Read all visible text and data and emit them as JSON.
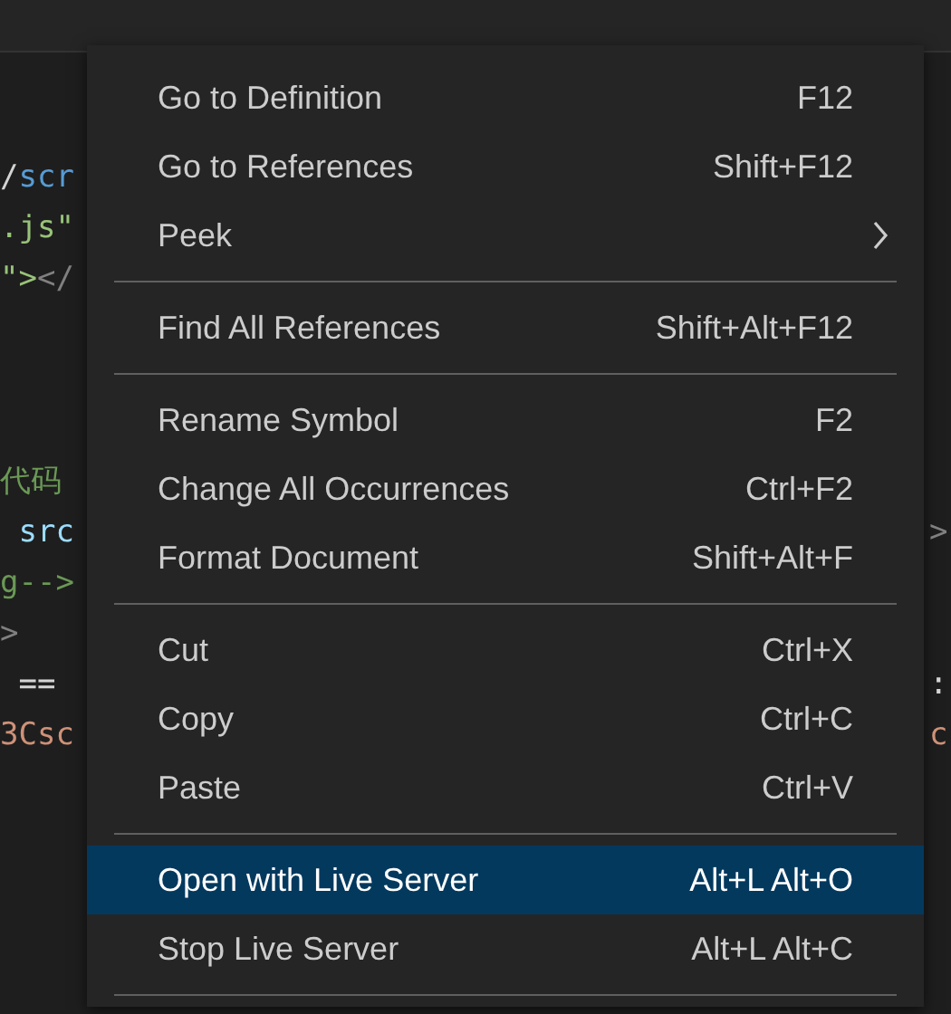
{
  "editor_left": [
    {
      "lines": [
        {
          "segments": [
            {
              "text": "/",
              "kind": "plain"
            },
            {
              "text": "scr",
              "kind": "tag"
            }
          ]
        },
        {
          "segments": [
            {
              "text": ".js\"",
              "kind": "string"
            }
          ]
        },
        {
          "segments": [
            {
              "text": "\">",
              "kind": "string"
            },
            {
              "text": "</",
              "kind": "punct"
            }
          ]
        }
      ]
    },
    {
      "lines": [
        {
          "segments": [
            {
              "text": "代码",
              "kind": "comment"
            }
          ]
        },
        {
          "segments": [
            {
              "text": " src",
              "kind": "attr"
            }
          ]
        },
        {
          "segments": [
            {
              "text": "g-->",
              "kind": "comment"
            }
          ]
        },
        {
          "segments": [
            {
              "text": ">",
              "kind": "punct"
            }
          ]
        },
        {
          "segments": [
            {
              "text": " == ",
              "kind": "plain"
            }
          ]
        },
        {
          "segments": [
            {
              "text": "3Csc",
              "kind": "string2"
            }
          ]
        }
      ]
    }
  ],
  "editor_right": [
    {
      "text": ">",
      "kind": "punct"
    },
    {
      "text": ":",
      "kind": "plain"
    },
    {
      "text": "c",
      "kind": "string2"
    }
  ],
  "menu": {
    "sections": [
      {
        "items": [
          {
            "label": "Go to Definition",
            "shortcut": "F12",
            "kind": "command",
            "selected": false
          },
          {
            "label": "Go to References",
            "shortcut": "Shift+F12",
            "kind": "command",
            "selected": false
          },
          {
            "label": "Peek",
            "kind": "submenu",
            "selected": false
          }
        ]
      },
      {
        "items": [
          {
            "label": "Find All References",
            "shortcut": "Shift+Alt+F12",
            "kind": "command",
            "selected": false
          }
        ]
      },
      {
        "items": [
          {
            "label": "Rename Symbol",
            "shortcut": "F2",
            "kind": "command",
            "selected": false
          },
          {
            "label": "Change All Occurrences",
            "shortcut": "Ctrl+F2",
            "kind": "command",
            "selected": false
          },
          {
            "label": "Format Document",
            "shortcut": "Shift+Alt+F",
            "kind": "command",
            "selected": false
          }
        ]
      },
      {
        "items": [
          {
            "label": "Cut",
            "shortcut": "Ctrl+X",
            "kind": "command",
            "selected": false
          },
          {
            "label": "Copy",
            "shortcut": "Ctrl+C",
            "kind": "command",
            "selected": false
          },
          {
            "label": "Paste",
            "shortcut": "Ctrl+V",
            "kind": "command",
            "selected": false
          }
        ]
      },
      {
        "items": [
          {
            "label": "Open with Live Server",
            "shortcut": "Alt+L Alt+O",
            "kind": "command",
            "selected": true
          },
          {
            "label": "Stop Live Server",
            "shortcut": "Alt+L Alt+C",
            "kind": "command",
            "selected": false
          }
        ]
      }
    ]
  }
}
